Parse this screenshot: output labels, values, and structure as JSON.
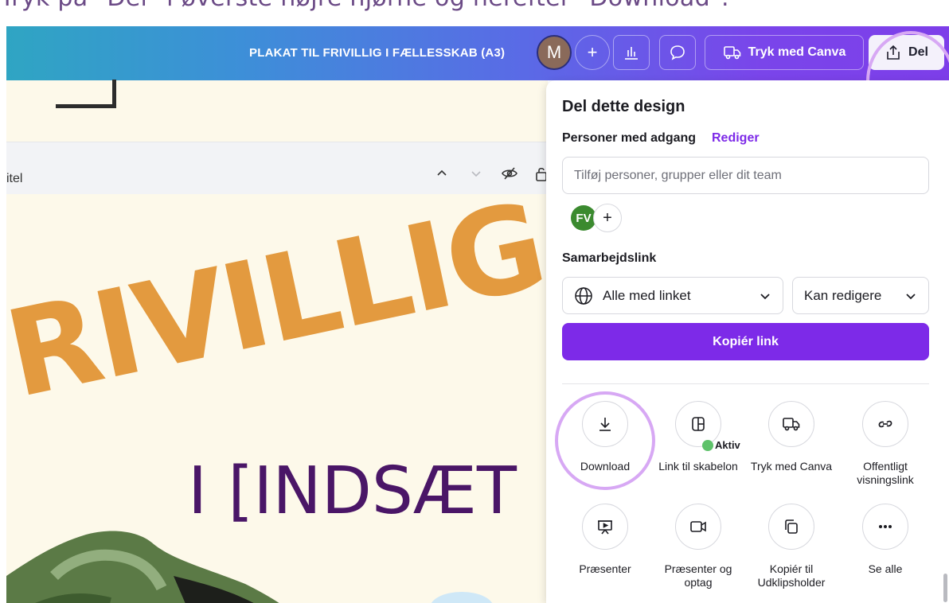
{
  "caption": "Tryk på \"Del\" i øverste højre hjørne og herefter \"Download\".",
  "topbar": {
    "design_title": "PLAKAT TIL FRIVILLIG I FÆLLESSKAB (A3)",
    "avatar_initial": "M",
    "add_label": "+",
    "print_button": "Tryk med Canva",
    "share_button": "Del",
    "gradient_start": "#2fa5c3",
    "gradient_end": "#7d3ee9"
  },
  "page_bar": {
    "title_fragment": "itel"
  },
  "canvas": {
    "headline": "RIVILLIG",
    "subline": "I [INDSÆT",
    "headline_color": "#e39a3f",
    "subline_color": "#4a1667"
  },
  "share_panel": {
    "title": "Del dette design",
    "access_label": "Personer med adgang",
    "access_edit": "Rediger",
    "people_placeholder": "Tilføj personer, grupper eller dit team",
    "member_initials": "FV",
    "add_member": "+",
    "collab_label": "Samarbejdslink",
    "link_access": "Alle med linket",
    "link_permission": "Kan redigere",
    "copy_link": "Kopiér link",
    "accent": "#7d2ae8",
    "options": [
      {
        "label": "Download",
        "icon": "download-icon"
      },
      {
        "label": "Link til skabelon",
        "icon": "template-icon",
        "badge": "Aktiv"
      },
      {
        "label": "Tryk med Canva",
        "icon": "truck-icon"
      },
      {
        "label": "Offentligt visningslink",
        "icon": "link-icon"
      },
      {
        "label": "Præsenter",
        "icon": "presentation-icon"
      },
      {
        "label": "Præsenter og optag",
        "icon": "camera-icon"
      },
      {
        "label": "Kopiér til Udklipsholder",
        "icon": "clipboard-icon"
      },
      {
        "label": "Se alle",
        "icon": "more-icon"
      }
    ]
  }
}
